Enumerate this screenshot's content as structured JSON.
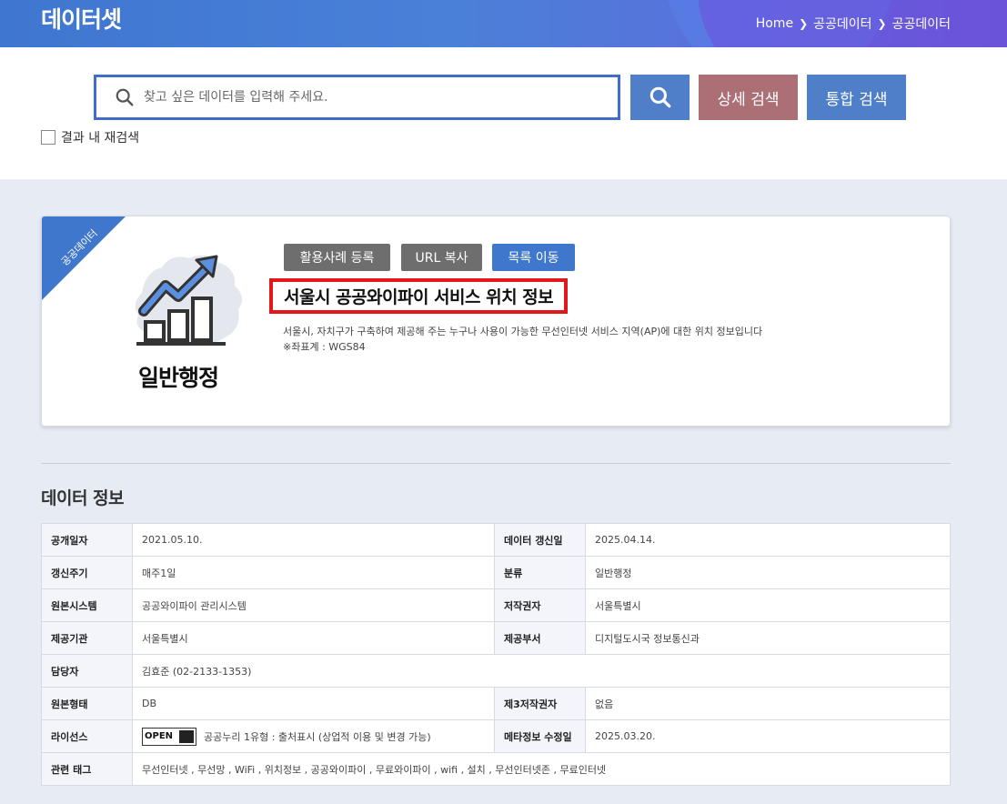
{
  "header": {
    "title": "데이터셋",
    "breadcrumb": [
      "Home",
      "공공데이터",
      "공공데이터"
    ]
  },
  "search": {
    "placeholder": "찾고 싶은 데이터를 입력해 주세요.",
    "detail_label": "상세 검색",
    "total_label": "통합 검색",
    "research_label": "결과 내 재검색",
    "colors": {
      "search": "#4f7fc9",
      "detail": "#ad6f76"
    }
  },
  "card": {
    "ribbon": "공공데이터",
    "category": "일반행정",
    "actions": {
      "case": "활용사례 등록",
      "url": "URL 복사",
      "list": "목록 이동"
    },
    "title": "서울시 공공와이파이 서비스 위치 정보",
    "description": "서울시, 자치구가 구축하여 제공해 주는 누구나 사용이 가능한 무선인터넷 서비스 지역(AP)에 대한 위치 정보입니다",
    "note": "※좌표계 : WGS84"
  },
  "info": {
    "section_title": "데이터 정보",
    "rows": {
      "open_date": {
        "label": "공개일자",
        "value": "2021.05.10."
      },
      "update_date": {
        "label": "데이터 갱신일",
        "value": "2025.04.14."
      },
      "cycle": {
        "label": "갱신주기",
        "value": "매주1일"
      },
      "category": {
        "label": "분류",
        "value": "일반행정"
      },
      "system": {
        "label": "원본시스템",
        "value": "공공와이파이 관리시스템"
      },
      "copyright": {
        "label": "저작권자",
        "value": "서울특별시"
      },
      "provider": {
        "label": "제공기관",
        "value": "서울특별시"
      },
      "dept": {
        "label": "제공부서",
        "value": "디지털도시국 정보통신과"
      },
      "manager": {
        "label": "담당자",
        "value": "김효준 (02-2133-1353)"
      },
      "format": {
        "label": "원본형태",
        "value": "DB"
      },
      "third_copyright": {
        "label": "제3저작권자",
        "value": "없음"
      },
      "license": {
        "label": "라이선스",
        "badge": "OPEN",
        "value": "공공누리 1유형 : 출처표시 (상업적 이용 및 변경 가능)"
      },
      "meta_date": {
        "label": "메타정보 수정일",
        "value": "2025.03.20."
      },
      "tags": {
        "label": "관련 태그",
        "value": "무선인터넷 , 무선망 , WiFi , 위치정보 , 공공와이파이 , 무료와이파이 , wifi , 설치 , 무선인터넷존 , 무료인터넷"
      }
    }
  }
}
